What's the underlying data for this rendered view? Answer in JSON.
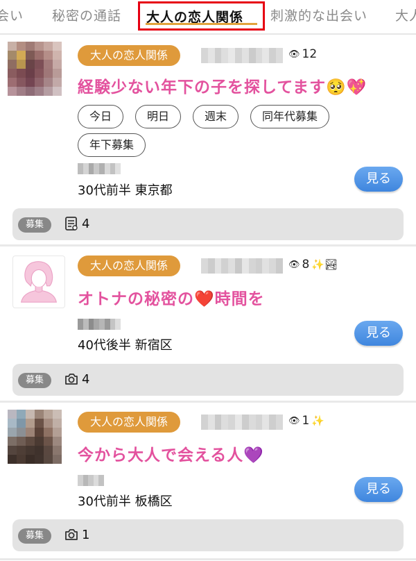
{
  "tabs": [
    {
      "label": "出会い",
      "active": false
    },
    {
      "label": "秘密の通話",
      "active": false
    },
    {
      "label": "大人の恋人関係",
      "active": true
    },
    {
      "label": "刺激的な出会い",
      "active": false
    },
    {
      "label": "大人",
      "active": false
    }
  ],
  "colors": {
    "accent_underline": "#e2a33c",
    "highlight_box": "#e60012",
    "category_badge": "#df9a3b",
    "title_pink": "#e3529e",
    "view_button": "#4a8ee0",
    "recruit_badge": "#888888"
  },
  "posts": [
    {
      "category": "大人の恋人関係",
      "views": "12",
      "view_extras": "",
      "title": "経験少ない年下の子を探してます🥺💖",
      "tags": [
        "今日",
        "明日",
        "週末",
        "同年代募集",
        "年下募集"
      ],
      "location": "30代前半 東京都",
      "button": "見る",
      "footer_badge": "募集",
      "footer_icon": "document-icon",
      "footer_count": "4"
    },
    {
      "category": "大人の恋人関係",
      "views": "8",
      "view_extras": "✨🏞",
      "title": "オトナの秘密の❤️時間を",
      "tags": [],
      "location": "40代後半 新宿区",
      "button": "見る",
      "footer_badge": "募集",
      "footer_icon": "camera-icon",
      "footer_count": "4"
    },
    {
      "category": "大人の恋人関係",
      "views": "1",
      "view_extras": "✨",
      "title": "今から大人で会える人💜",
      "tags": [],
      "location": "30代前半 板橋区",
      "button": "見る",
      "footer_badge": "募集",
      "footer_icon": "camera-icon",
      "footer_count": "1"
    }
  ]
}
